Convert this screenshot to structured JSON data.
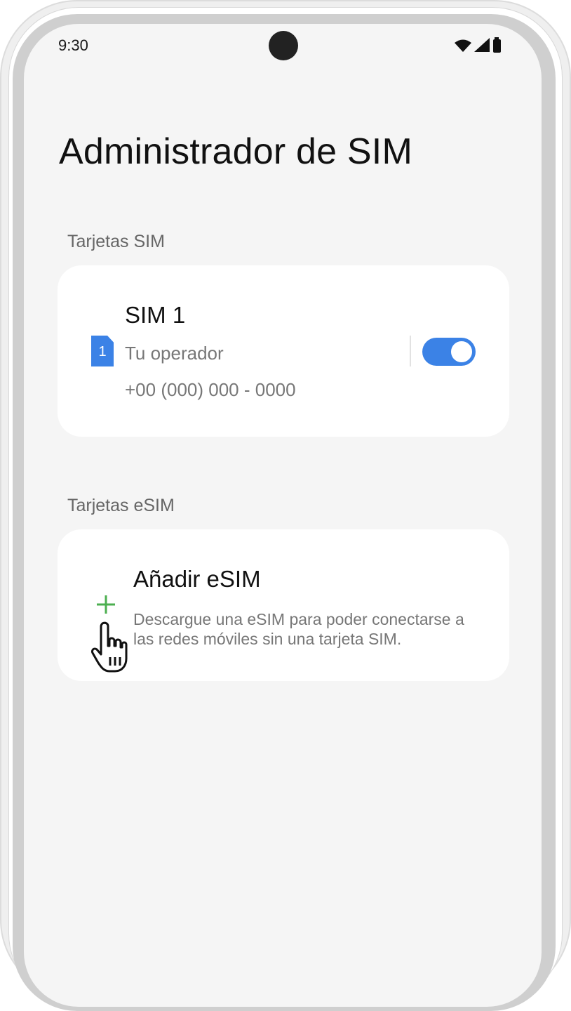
{
  "status_bar": {
    "time": "9:30",
    "icons": [
      "wifi-icon",
      "signal-icon",
      "battery-icon"
    ]
  },
  "page": {
    "title": "Administrador de SIM"
  },
  "sim_section": {
    "label": "Tarjetas SIM",
    "cards": [
      {
        "name": "SIM 1",
        "slot_badge": "1",
        "operator": "Tu operador",
        "number": "+00 (000) 000 - 0000",
        "enabled": true
      }
    ]
  },
  "esim_section": {
    "label": "Tarjetas eSIM",
    "add_title": "Añadir eSIM",
    "add_description": "Descargue una eSIM para poder conectarse a las redes móviles sin una tarjeta SIM.",
    "icon": "plus-icon"
  },
  "colors": {
    "accent": "#3b82e6",
    "plus": "#4caf50",
    "background": "#f5f5f5",
    "card": "#ffffff"
  }
}
